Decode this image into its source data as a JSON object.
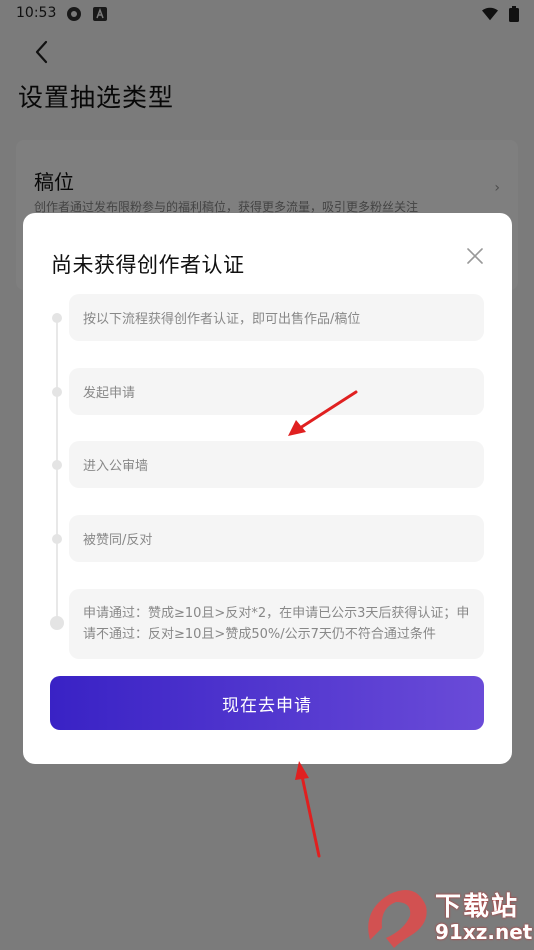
{
  "status_bar": {
    "time": "10:53"
  },
  "page": {
    "title": "设置抽选类型",
    "card": {
      "title": "稿位",
      "description": "创作者通过发布限粉参与的福利稿位，获得更多流量，吸引更多粉丝关注"
    }
  },
  "modal": {
    "title": "尚未获得创作者认证",
    "steps": [
      "按以下流程获得创作者认证，即可出售作品/稿位",
      "发起申请",
      "进入公审墙",
      "被赞同/反对",
      "申请通过：赞成≥10且>反对*2，在申请已公示3天后获得认证；申请不通过：反对≥10且>赞成50%/公示7天仍不符合通过条件"
    ],
    "button_label": "现在去申请"
  },
  "watermark": {
    "text": "下载站",
    "url": "91xz.net"
  },
  "colors": {
    "button_start": "#3922c5",
    "button_end": "#6a4bd8",
    "arrow": "#e02020"
  }
}
